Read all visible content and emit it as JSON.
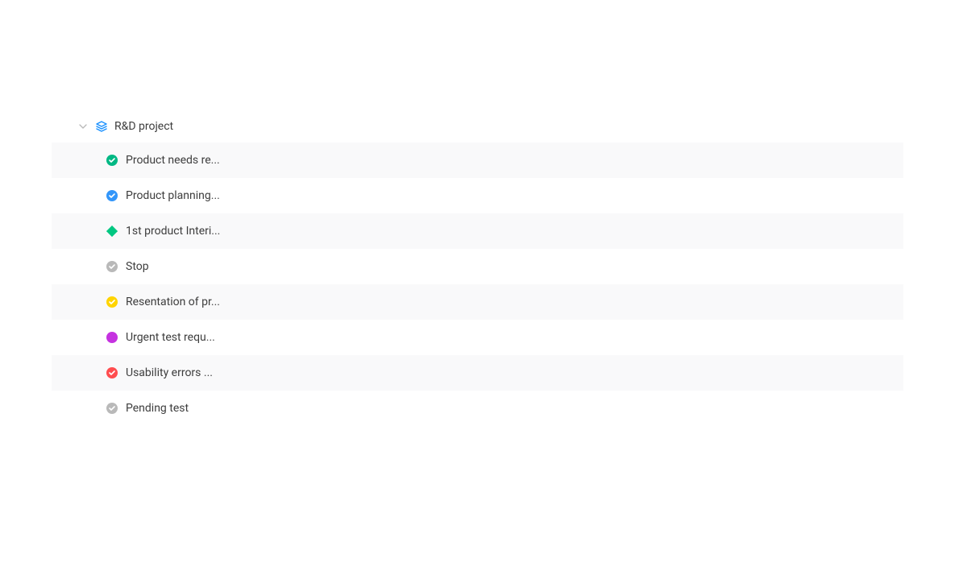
{
  "project": {
    "title": "R&D project"
  },
  "tasks": [
    {
      "label": "Product needs re...",
      "status": "done-green",
      "color": "#00b884"
    },
    {
      "label": "Product planning...",
      "status": "done-blue",
      "color": "#3296fa"
    },
    {
      "label": "1st product Interi...",
      "status": "milestone",
      "color": "#00c781"
    },
    {
      "label": "Stop",
      "status": "done-gray",
      "color": "#b9b9b9"
    },
    {
      "label": "Resentation of pr...",
      "status": "done-yellow",
      "color": "#ffd400"
    },
    {
      "label": "Urgent test requ...",
      "status": "dot-purple",
      "color": "#c532e0"
    },
    {
      "label": "Usability errors ...",
      "status": "done-red",
      "color": "#ff4d4f"
    },
    {
      "label": "Pending test",
      "status": "done-gray",
      "color": "#b9b9b9"
    }
  ],
  "colors": {
    "chevron": "#b9b9b9",
    "layers": "#1890ff",
    "text": "#3d3d3d",
    "row_alt": "#f9f9fa"
  }
}
